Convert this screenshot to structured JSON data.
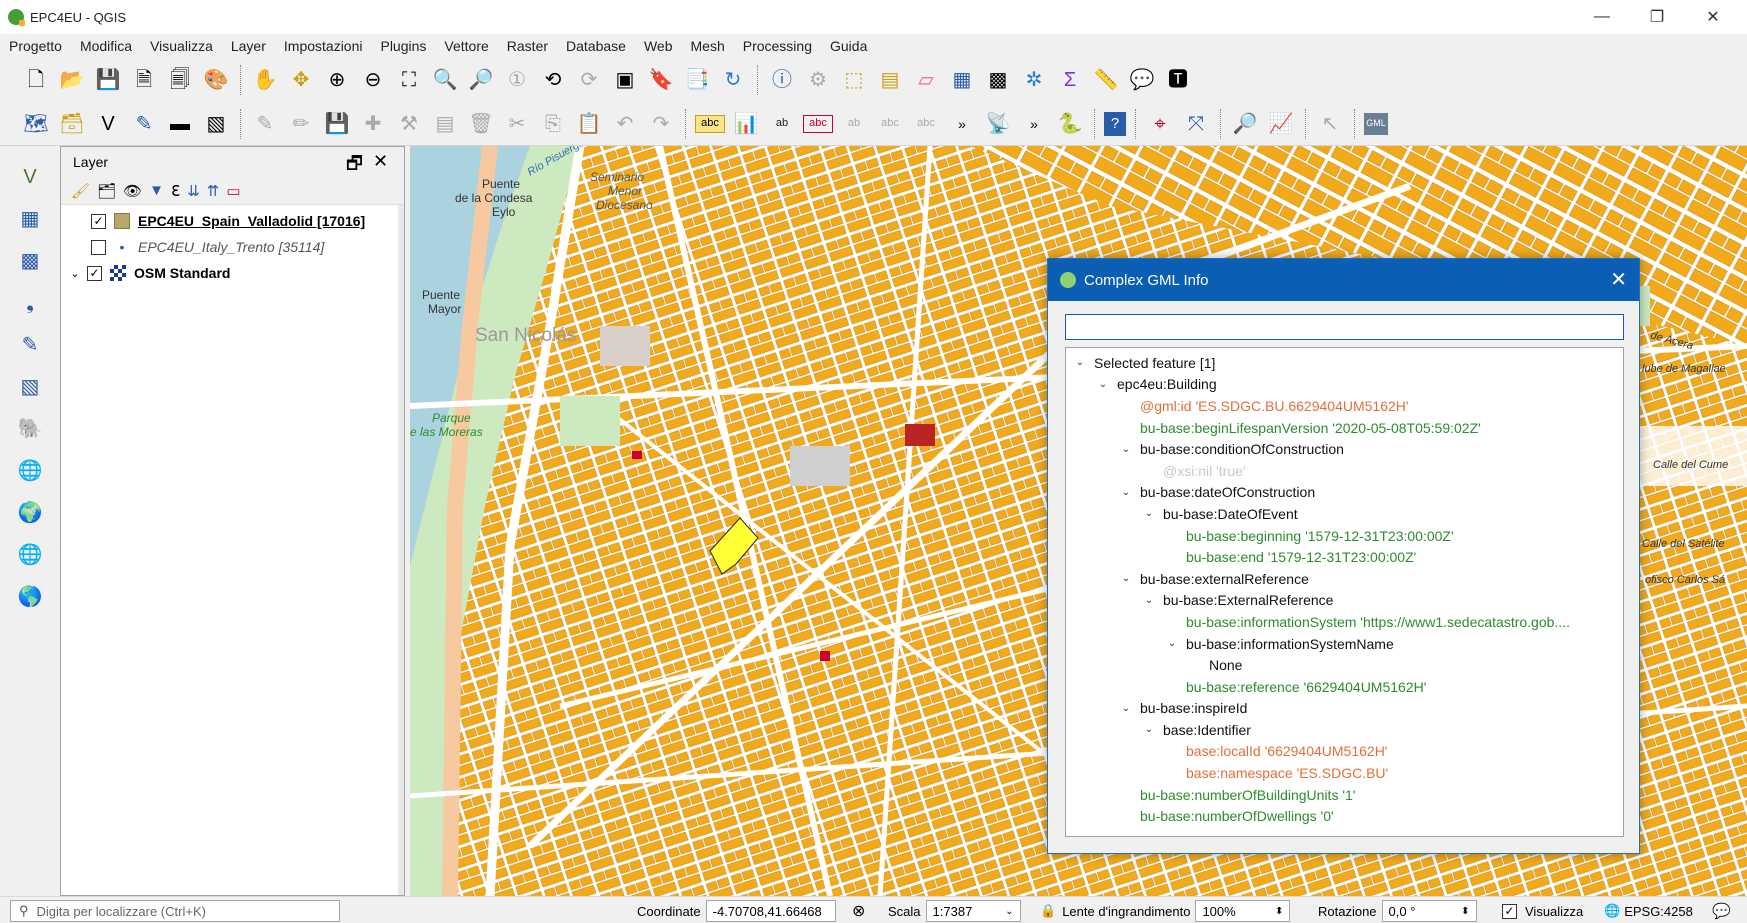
{
  "window": {
    "title": "EPC4EU - QGIS",
    "minimize": "—",
    "restore": "❐",
    "close": "✕"
  },
  "menu": [
    "Progetto",
    "Modifica",
    "Visualizza",
    "Layer",
    "Impostazioni",
    "Plugins",
    "Vettore",
    "Raster",
    "Database",
    "Web",
    "Mesh",
    "Processing",
    "Guida"
  ],
  "layers_panel": {
    "title": "Layer",
    "float_icon": "🗗",
    "close_icon": "✕",
    "layers": [
      {
        "name": "EPC4EU_Spain_Valladolid [17016]",
        "checked": "✓",
        "expander": ""
      },
      {
        "name": "EPC4EU_Italy_Trento [35114]",
        "checked": "",
        "expander": ""
      },
      {
        "name": "OSM Standard",
        "checked": "✓",
        "expander": "⌄"
      }
    ]
  },
  "map_labels": {
    "puente": "Puente",
    "condesa": "de la Condesa",
    "eylo": "Eylo",
    "puente_mayor": "Puente",
    "mayor": "Mayor",
    "san_nicolas": "San Nicolás",
    "parque": "Parque",
    "los_moreras": "e las Moreras",
    "calle_del_cume": "Calle del Cume",
    "calle_satelite": "Calle del Satélite",
    "carlos": "ofisco Carlos Sá",
    "acera": "de Acera",
    "magallanes": "lube de Magallae",
    "rio": "Río Pisuerga",
    "seminario": "Seminario",
    "menor": "Menor",
    "diocesano": "Diocesano"
  },
  "gml_dialog": {
    "title": "Complex GML Info",
    "close": "✕",
    "search_value": "",
    "tree": [
      {
        "indent": 0,
        "arrow": "⌄",
        "text": "Selected feature [1]",
        "color": "black"
      },
      {
        "indent": 1,
        "arrow": "⌄",
        "text": "epc4eu:Building",
        "color": "black"
      },
      {
        "indent": 2,
        "arrow": "",
        "text": "@gml:id 'ES.SDGC.BU.6629404UM5162H'",
        "color": "orange"
      },
      {
        "indent": 2,
        "arrow": "",
        "text": "bu-base:beginLifespanVersion '2020-05-08T05:59:02Z'",
        "color": "green"
      },
      {
        "indent": 2,
        "arrow": "⌄",
        "text": "bu-base:conditionOfConstruction",
        "color": "black"
      },
      {
        "indent": 3,
        "arrow": "",
        "text": "@xsi:nil 'true'",
        "color": "gray"
      },
      {
        "indent": 2,
        "arrow": "⌄",
        "text": "bu-base:dateOfConstruction",
        "color": "black"
      },
      {
        "indent": 3,
        "arrow": "⌄",
        "text": "bu-base:DateOfEvent",
        "color": "black"
      },
      {
        "indent": 4,
        "arrow": "",
        "text": "bu-base:beginning '1579-12-31T23:00:00Z'",
        "color": "green"
      },
      {
        "indent": 4,
        "arrow": "",
        "text": "bu-base:end '1579-12-31T23:00:00Z'",
        "color": "green"
      },
      {
        "indent": 2,
        "arrow": "⌄",
        "text": "bu-base:externalReference",
        "color": "black"
      },
      {
        "indent": 3,
        "arrow": "⌄",
        "text": "bu-base:ExternalReference",
        "color": "black"
      },
      {
        "indent": 4,
        "arrow": "",
        "text": "bu-base:informationSystem 'https://www1.sedecatastro.gob....",
        "color": "green"
      },
      {
        "indent": 4,
        "arrow": "⌄",
        "text": "bu-base:informationSystemName",
        "color": "black"
      },
      {
        "indent": 5,
        "arrow": "",
        "text": "None",
        "color": "black"
      },
      {
        "indent": 4,
        "arrow": "",
        "text": "bu-base:reference '6629404UM5162H'",
        "color": "green"
      },
      {
        "indent": 2,
        "arrow": "⌄",
        "text": "bu-base:inspireId",
        "color": "black"
      },
      {
        "indent": 3,
        "arrow": "⌄",
        "text": "base:Identifier",
        "color": "black"
      },
      {
        "indent": 4,
        "arrow": "",
        "text": "base:localId '6629404UM5162H'",
        "color": "orange"
      },
      {
        "indent": 4,
        "arrow": "",
        "text": "base:namespace 'ES.SDGC.BU'",
        "color": "orange"
      },
      {
        "indent": 2,
        "arrow": "",
        "text": "bu-base:numberOfBuildingUnits '1'",
        "color": "green"
      },
      {
        "indent": 2,
        "arrow": "",
        "text": "bu-base:numberOfDwellings '0'",
        "color": "green"
      }
    ]
  },
  "statusbar": {
    "locator_placeholder": "Digita per localizzare (Ctrl+K)",
    "coord_label": "Coordinate",
    "coord_value": "-4.70708,41.66468",
    "scale_label": "Scala",
    "scale_value": "1:7387",
    "magnifier_label": "Lente d'ingrandimento",
    "magnifier_value": "100%",
    "rotation_label": "Rotazione",
    "rotation_value": "0,0 °",
    "render_label": "Visualizza",
    "crs": "EPSG:4258"
  },
  "colors": {
    "buildings": "#f2a91a",
    "roads": "#ffffff",
    "park": "#cde9c0",
    "river": "#aad3df",
    "selected": "#ffff33",
    "titlebar_accent": "#0a5fb4"
  }
}
